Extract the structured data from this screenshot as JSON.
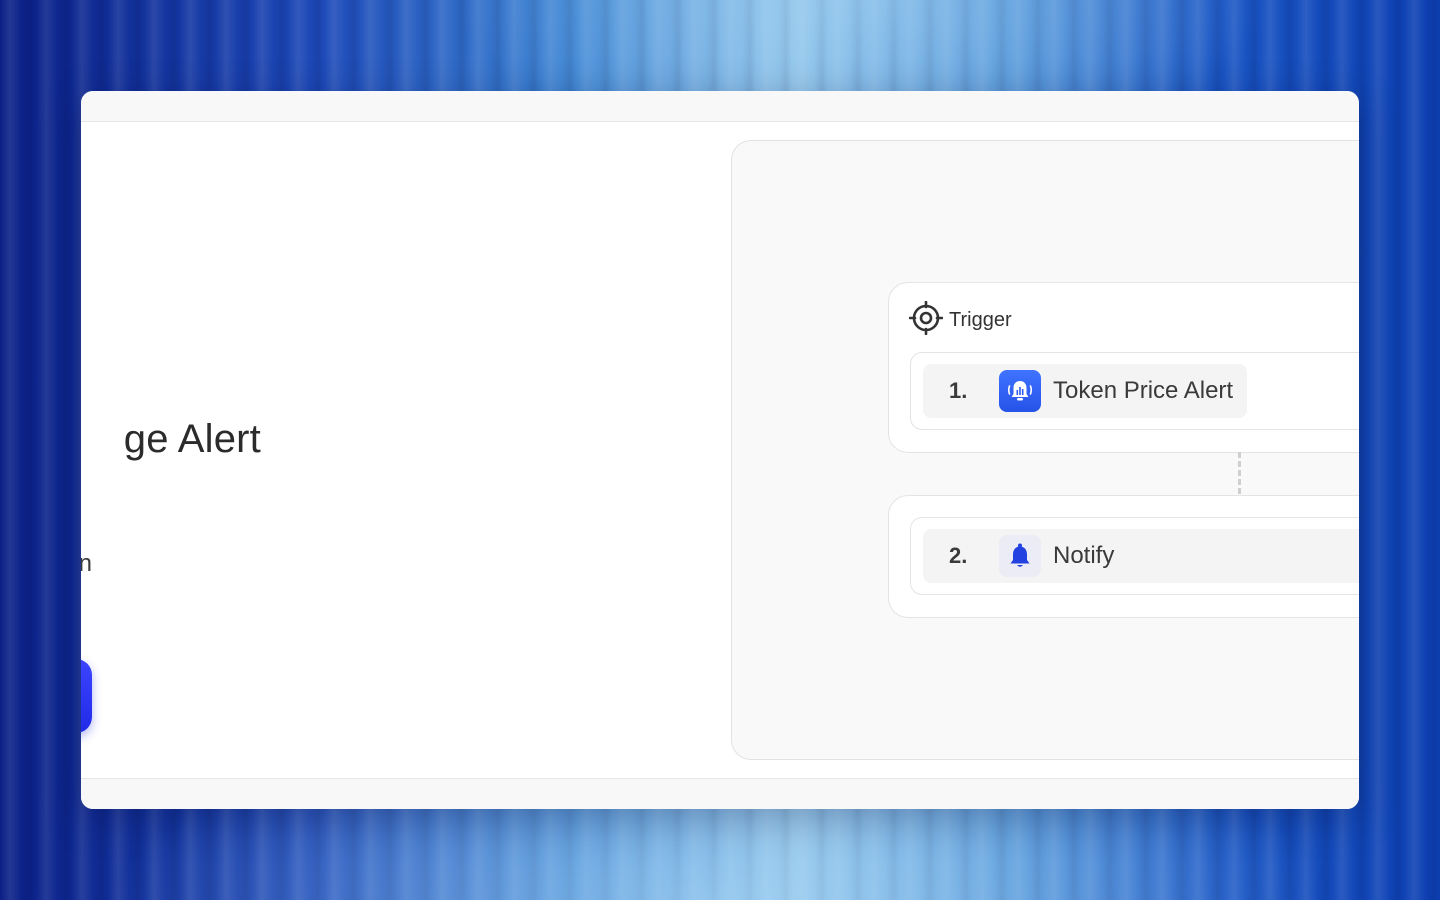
{
  "hero": {
    "title": "ge Alert",
    "subtitle": "n"
  },
  "workflow": {
    "trigger_card": {
      "label": "Trigger",
      "icon": "target-icon",
      "step": {
        "number": "1.",
        "name": "Token Price Alert",
        "icon": "price-alert-bell-icon"
      }
    },
    "action_card": {
      "step": {
        "number": "2.",
        "name": "Notify",
        "icon": "bell-icon"
      }
    }
  },
  "colors": {
    "accent": "#2a35f0",
    "app_icon_blue": "#3365f5",
    "bell_blue": "#2340e0"
  }
}
